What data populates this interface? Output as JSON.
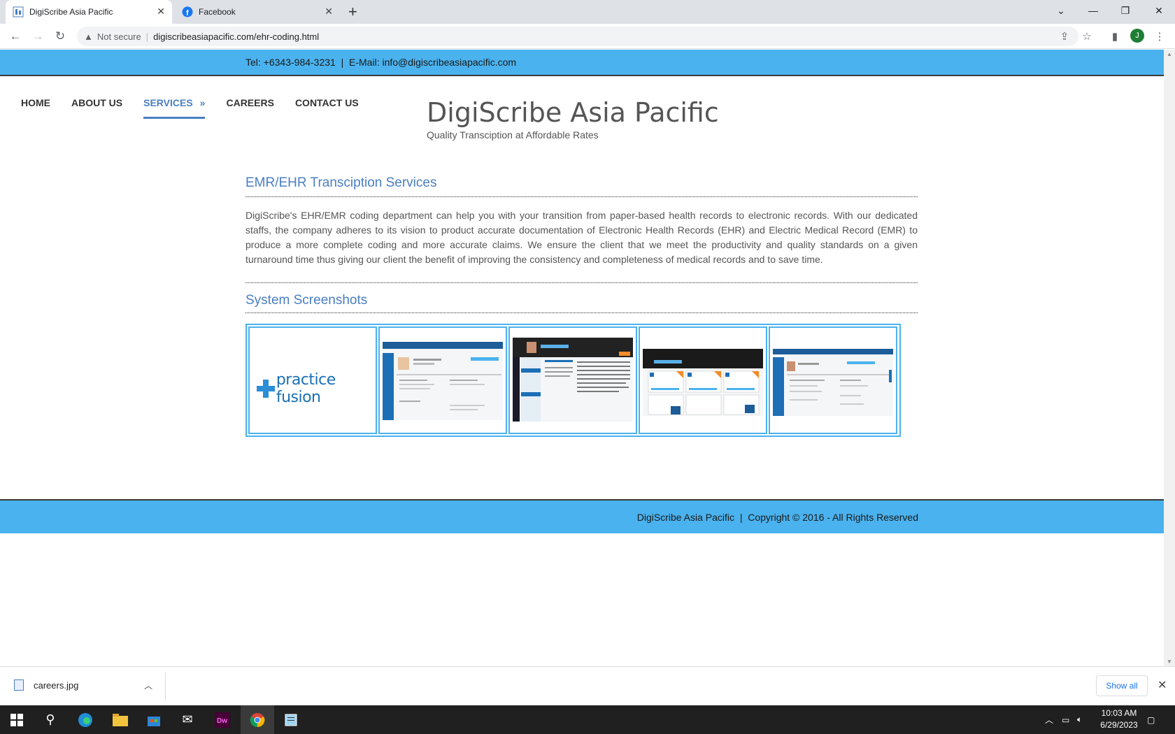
{
  "browser": {
    "tabs": [
      {
        "title": "DigiScribe Asia Pacific",
        "active": true
      },
      {
        "title": "Facebook",
        "active": false
      }
    ],
    "security_label": "Not secure",
    "url": "digiscribeasiapacific.com/ehr-coding.html",
    "avatar_initial": "J"
  },
  "site": {
    "contact_line": "Tel: +6343-984-3231  |  E-Mail: info@digiscribeasiapacific.com",
    "nav": [
      "HOME",
      "ABOUT US",
      "SERVICES",
      "CAREERS",
      "CONTACT US"
    ],
    "nav_active_suffix": "»",
    "brand_title": "DigiScribe Asia Pacific",
    "brand_tagline": "Quality Transciption at Affordable Rates",
    "section_title": "EMR/EHR Transciption Services",
    "paragraph": "DigiScribe's EHR/EMR coding department can help you with your transition from paper-based health records to electronic records. With our dedicated staffs, the company adheres to its vision to product accurate documentation of Electronic Health Records (EHR) and Electric Medical Record (EMR) to produce a more complete coding and more accurate claims. We ensure the client that we meet the productivity and quality standards on a given turnaround time thus giving our client the benefit of improving the consistency and completeness of medical records and to save time.",
    "screenshots_title": "System Screenshots",
    "logo_text": "practice fusion",
    "footer": "DigiScribe Asia Pacific  |  Copyright © 2016 - All Rights Reserved"
  },
  "downloads": {
    "file": "careers.jpg",
    "show_all": "Show all"
  },
  "taskbar": {
    "time": "10:03 AM",
    "date": "6/29/2023"
  },
  "colors": {
    "accent": "#4ab2ee",
    "heading": "#4a7fc1"
  }
}
